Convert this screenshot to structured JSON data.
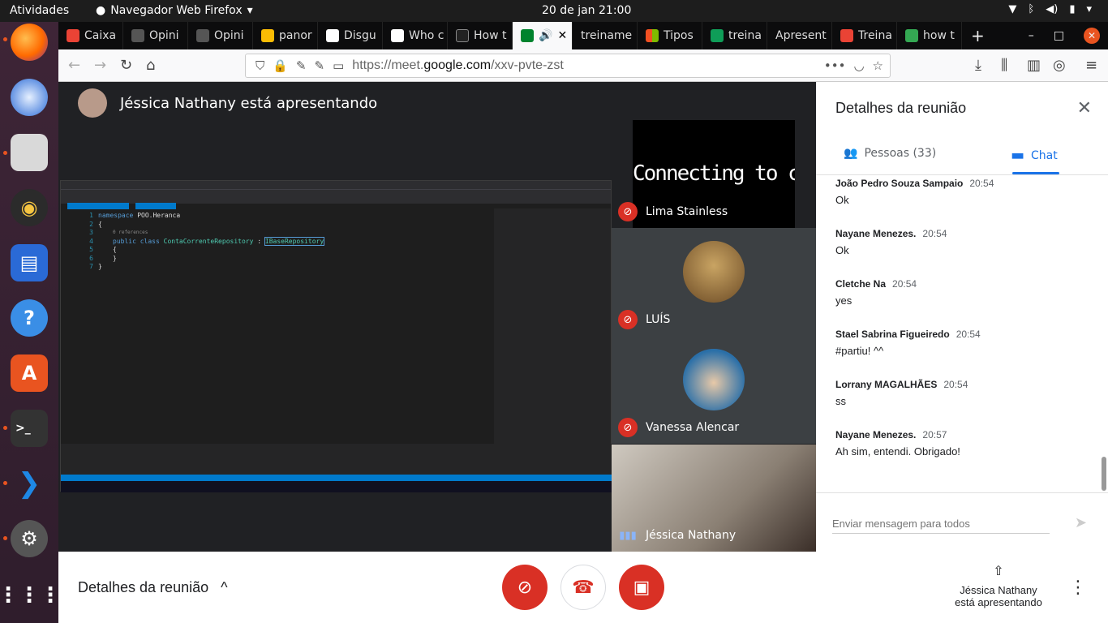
{
  "system": {
    "activities": "Atividades",
    "app_name": "Navegador Web Firefox",
    "clock": "20 de jan  21:00"
  },
  "browser": {
    "tabs": [
      {
        "label": "Caixa",
        "color": "#ea4335"
      },
      {
        "label": "Opini",
        "color": "#444"
      },
      {
        "label": "Opini",
        "color": "#444"
      },
      {
        "label": "panor",
        "color": "#fbbc04"
      },
      {
        "label": "Disgu",
        "color": "#222"
      },
      {
        "label": "Who c",
        "color": "#222"
      },
      {
        "label": "How t",
        "color": "#333"
      },
      {
        "label": "",
        "color": "#00832d"
      },
      {
        "label": "treiname",
        "color": "#fff"
      },
      {
        "label": "Tipos",
        "color": "#f25022"
      },
      {
        "label": "treina",
        "color": "#0f9d58"
      },
      {
        "label": "Apresent",
        "color": "#fff"
      },
      {
        "label": "Treina",
        "color": "#ea4335"
      },
      {
        "label": "how t",
        "color": "#34a853"
      }
    ],
    "url_prefix": "https://meet.",
    "url_domain": "google.com",
    "url_path": "/xxv-pvte-zst"
  },
  "meet": {
    "presenter_label": "Jéssica Nathany está apresentando",
    "code": {
      "lines": [
        "1",
        "2",
        "3",
        "4",
        "5",
        "6",
        "7"
      ],
      "ns_kw": "namespace",
      "ns_name": "POO.Heranca",
      "refs": "0 references",
      "pub": "public class",
      "cls": "ContaCorrenteRepository",
      "colon": ":",
      "iface": "IBaseRepository"
    },
    "participants": [
      {
        "name": "Lima Stainless",
        "overlay": "Connecting to camera..."
      },
      {
        "name": "LUÍS"
      },
      {
        "name": "Vanessa Alencar"
      },
      {
        "name": "Jéssica Nathany"
      }
    ]
  },
  "panel": {
    "title": "Detalhes da reunião",
    "people_tab": "Pessoas (33)",
    "chat_tab": "Chat",
    "messages": [
      {
        "author": "João Pedro Souza Sampaio",
        "time": "20:54",
        "text": "Ok"
      },
      {
        "author": "Nayane Menezes.",
        "time": "20:54",
        "text": "Ok"
      },
      {
        "author": "Cletche Na",
        "time": "20:54",
        "text": "yes"
      },
      {
        "author": "Stael Sabrina Figueiredo",
        "time": "20:54",
        "text": "#partiu! ^^"
      },
      {
        "author": "Lorrany MAGALHÃES",
        "time": "20:54",
        "text": "ss"
      },
      {
        "author": "Nayane Menezes.",
        "time": "20:57",
        "text": "Ah sim, entendi. Obrigado!"
      }
    ],
    "compose_placeholder": "Enviar mensagem para todos"
  },
  "bottom": {
    "details": "Detalhes da reunião",
    "presenting_line1": "Jéssica Nathany",
    "presenting_line2": "está apresentando"
  }
}
